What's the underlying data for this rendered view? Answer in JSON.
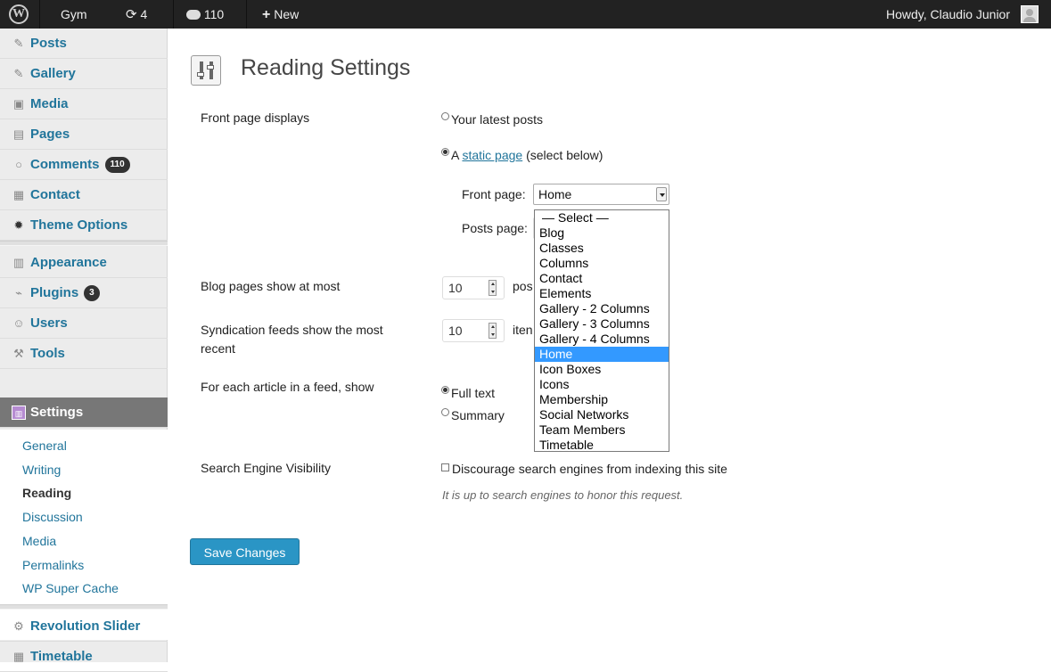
{
  "adminbar": {
    "site_name": "Gym",
    "updates_count": "4",
    "comments_count": "110",
    "new_label": "New",
    "greeting": "Howdy, Claudio Junior"
  },
  "sidebar": {
    "items": [
      {
        "label": "Posts",
        "icon": "pushpin-icon"
      },
      {
        "label": "Gallery",
        "icon": "pushpin-icon"
      },
      {
        "label": "Media",
        "icon": "camera-icon"
      },
      {
        "label": "Pages",
        "icon": "pages-icon"
      },
      {
        "label": "Comments",
        "icon": "comment-bubble-icon",
        "count": "110"
      },
      {
        "label": "Contact",
        "icon": "contact-form-icon"
      },
      {
        "label": "Theme Options",
        "icon": "gear-icon"
      },
      {
        "label": "Appearance",
        "icon": "appearance-icon"
      },
      {
        "label": "Plugins",
        "icon": "plugin-icon",
        "count": "3"
      },
      {
        "label": "Users",
        "icon": "users-icon"
      },
      {
        "label": "Tools",
        "icon": "tools-icon"
      },
      {
        "label": "Settings",
        "icon": "settings-icon"
      },
      {
        "label": "Revolution Slider",
        "icon": "gear-icon"
      },
      {
        "label": "Timetable",
        "icon": "calendar-icon"
      }
    ],
    "submenu": [
      "General",
      "Writing",
      "Reading",
      "Discussion",
      "Media",
      "Permalinks",
      "WP Super Cache"
    ]
  },
  "page": {
    "title": "Reading Settings",
    "front_page_displays": {
      "label": "Front page displays",
      "option_latest": "Your latest posts",
      "option_static_prefix": "A",
      "option_static_link": "static page",
      "option_static_suffix": "(select below)",
      "front_page_label": "Front page:",
      "front_page_value": "Home",
      "posts_page_label": "Posts page:"
    },
    "dropdown_options": [
      "— Select —",
      "Blog",
      "Classes",
      "Columns",
      "Contact",
      "Elements",
      "Gallery - 2 Columns",
      "Gallery - 3 Columns",
      "Gallery - 4 Columns",
      "Home",
      "Icon Boxes",
      "Icons",
      "Membership",
      "Social Networks",
      "Team Members",
      "Timetable"
    ],
    "dropdown_selected": "Home",
    "blog_pages": {
      "label": "Blog pages show at most",
      "value": "10",
      "unit": "pos"
    },
    "syndication": {
      "label": "Syndication feeds show the most recent",
      "value": "10",
      "unit": "iten"
    },
    "feed_article": {
      "label": "For each article in a feed, show",
      "option_full": "Full text",
      "option_summary": "Summary"
    },
    "search_visibility": {
      "label": "Search Engine Visibility",
      "checkbox_label": "Discourage search engines from indexing this site",
      "description": "It is up to search engines to honor this request."
    },
    "save_label": "Save Changes"
  },
  "colors": {
    "admin_bar": "#222222",
    "link": "#21759b",
    "current_menu": "#777777",
    "primary_button": "#2a95c5",
    "dropdown_highlight": "#3399ff"
  }
}
